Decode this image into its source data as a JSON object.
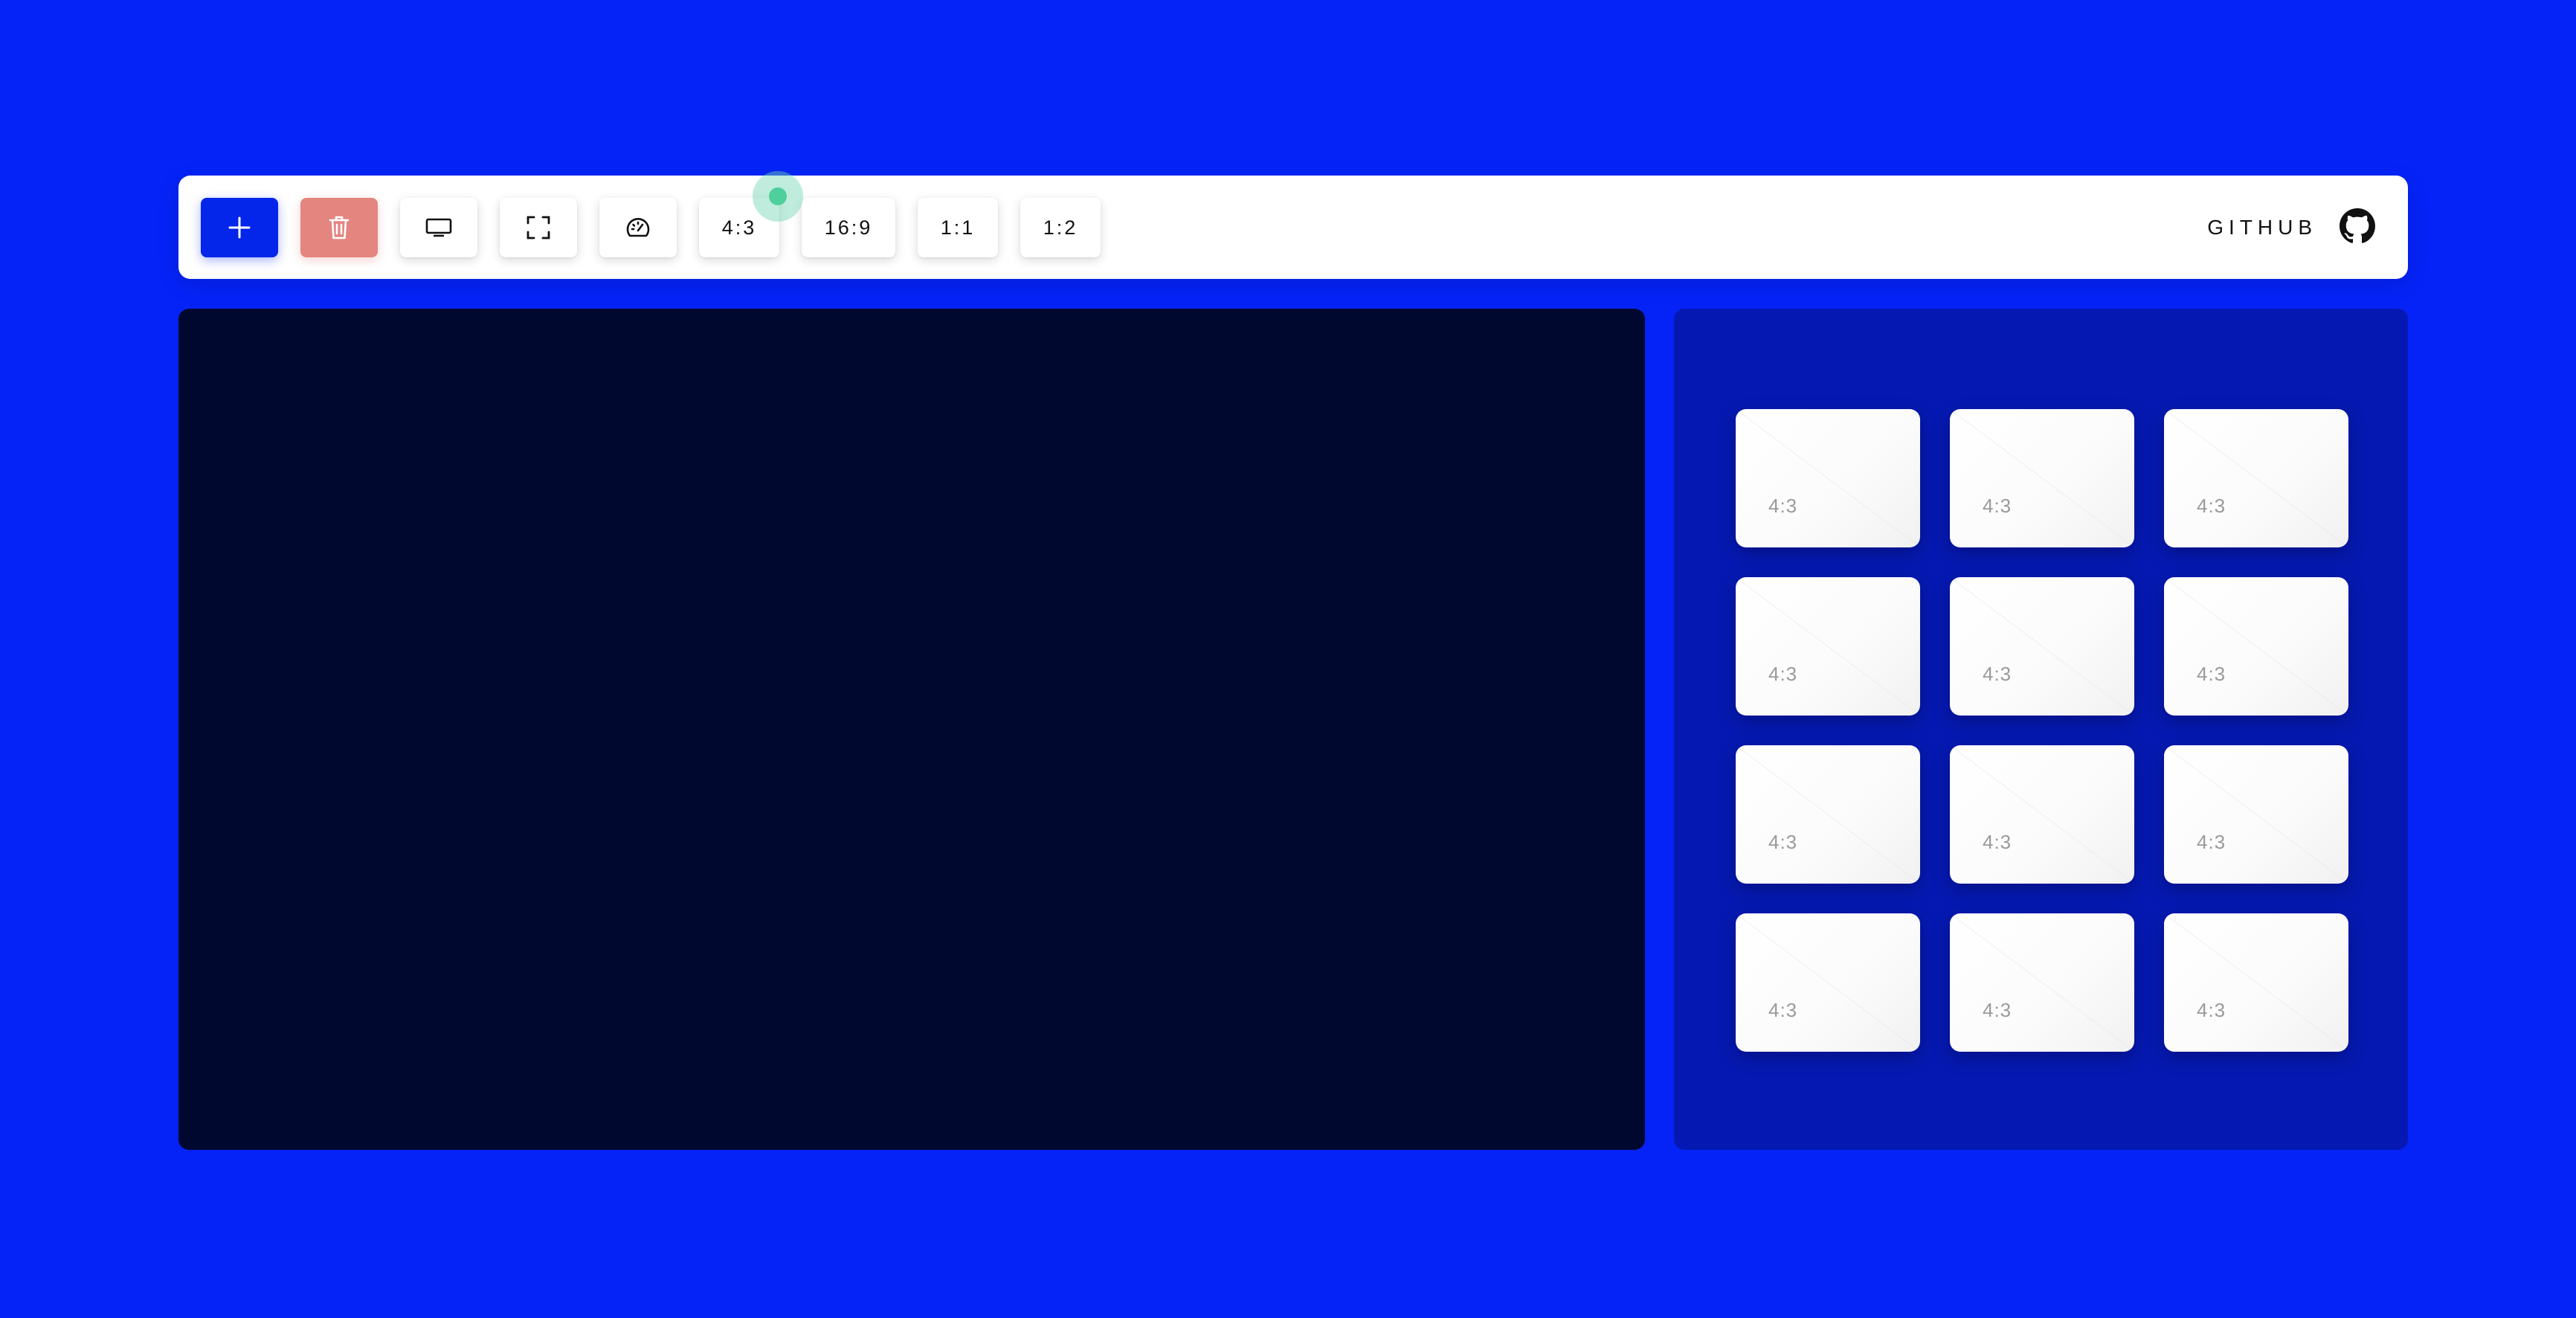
{
  "toolbar": {
    "add_icon": "plus-icon",
    "delete_icon": "trash-icon",
    "display_icon": "monitor-icon",
    "fullscreen_icon": "fullscreen-icon",
    "speed_icon": "speedometer-icon",
    "ratios": [
      "4:3",
      "16:9",
      "1:1",
      "1:2"
    ],
    "github_label": "GITHUB",
    "github_icon": "github-icon"
  },
  "colors": {
    "background": "#0523f7",
    "add_button": "#0425ea",
    "delete_button": "#e48580",
    "canvas": "#000830",
    "panel": "#0519b2",
    "focus_indicator": "#4fcf9c"
  },
  "panel": {
    "cards": [
      {
        "label": "4:3"
      },
      {
        "label": "4:3"
      },
      {
        "label": "4:3"
      },
      {
        "label": "4:3"
      },
      {
        "label": "4:3"
      },
      {
        "label": "4:3"
      },
      {
        "label": "4:3"
      },
      {
        "label": "4:3"
      },
      {
        "label": "4:3"
      },
      {
        "label": "4:3"
      },
      {
        "label": "4:3"
      },
      {
        "label": "4:3"
      }
    ]
  }
}
